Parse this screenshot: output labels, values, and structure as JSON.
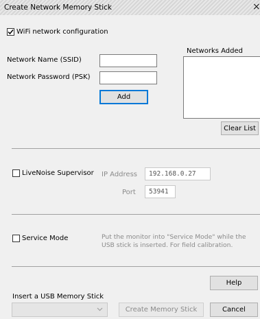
{
  "window": {
    "title": "Create Network Memory Stick",
    "close_glyph": "×"
  },
  "wifi": {
    "checkbox_label": "WiFi network configuration",
    "checked": true,
    "ssid_label": "Network Name (SSID)",
    "ssid_value": "",
    "psk_label": "Network Password (PSK)",
    "psk_value": "",
    "add_label": "Add",
    "networks_added_label": "Networks Added",
    "networks_added_items": [],
    "clear_list_label": "Clear List"
  },
  "livenoise": {
    "checkbox_label": "LiveNoise Supervisor",
    "checked": false,
    "ip_label": "IP Address",
    "ip_value": "192.168.0.27",
    "port_label": "Port",
    "port_value": "53941"
  },
  "service": {
    "checkbox_label": "Service Mode",
    "checked": false,
    "description": "Put the monitor into \"Service Mode\" while the USB stick is inserted. For field calibration."
  },
  "footer": {
    "help_label": "Help",
    "insert_label": "Insert a USB Memory Stick",
    "usb_select_value": "",
    "create_label": "Create Memory Stick",
    "cancel_label": "Cancel"
  },
  "icons": [
    "close-icon",
    "checkmark-icon",
    "chevron-down-icon"
  ]
}
